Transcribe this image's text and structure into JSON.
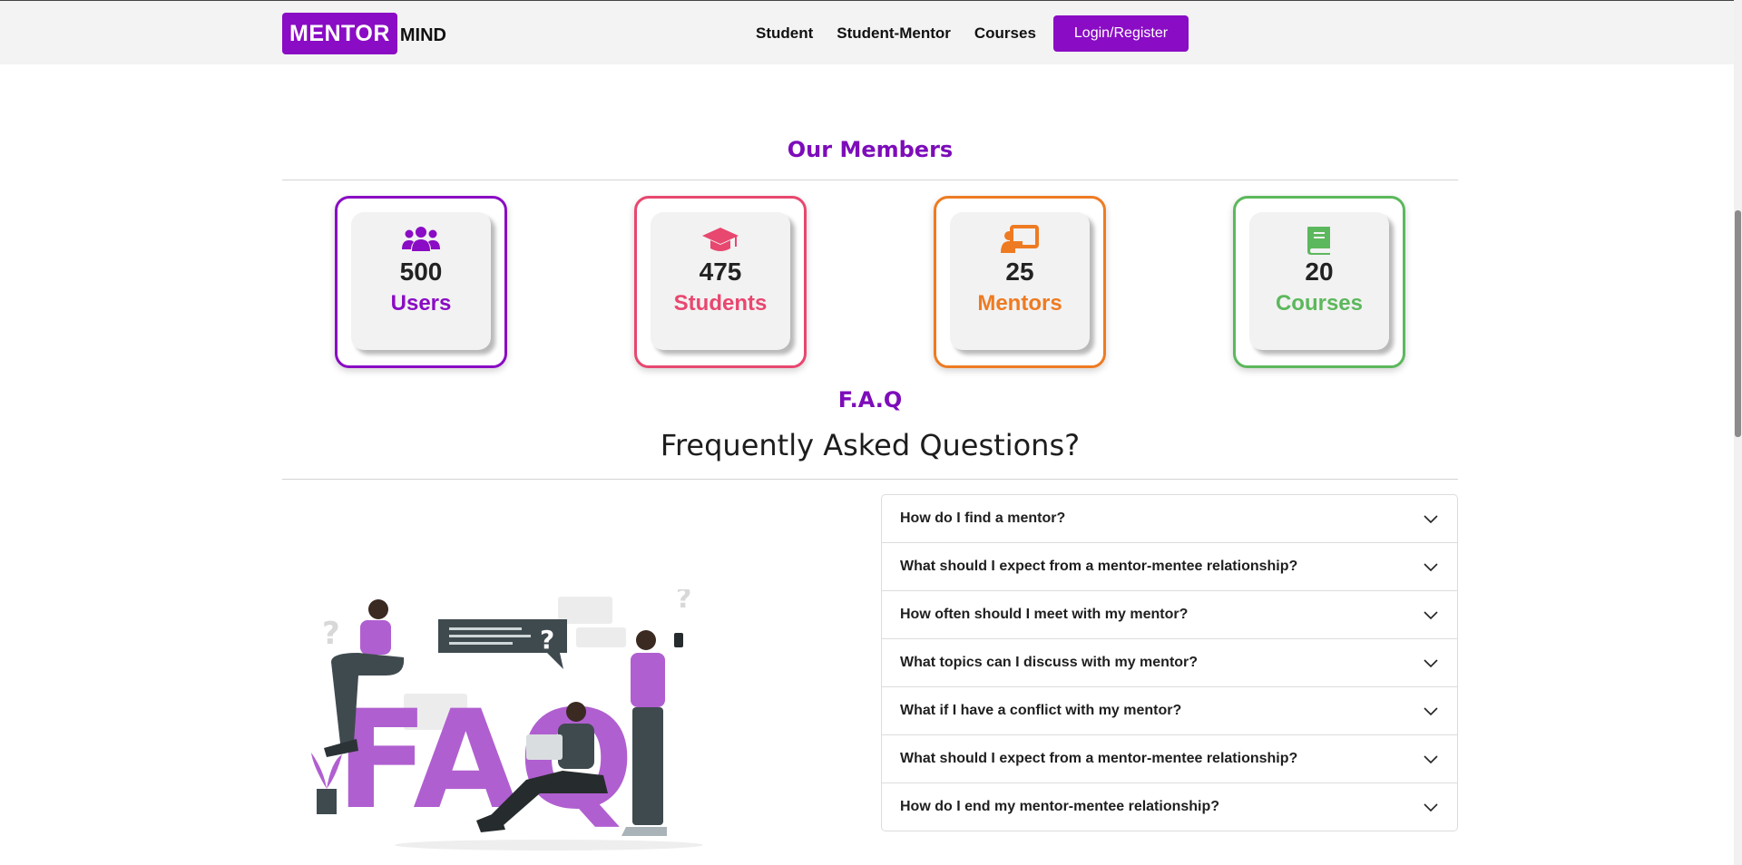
{
  "brand": {
    "box_text": "MENTOR",
    "rest_text": "MIND"
  },
  "nav": {
    "links": [
      "Student",
      "Student-Mentor",
      "Courses"
    ],
    "cta": "Login/Register"
  },
  "members": {
    "title": "Our Members",
    "stats": [
      {
        "number": "500",
        "label": "Users",
        "color": "#8a0cc4",
        "icon": "users-icon"
      },
      {
        "number": "475",
        "label": "Students",
        "color": "#e8476f",
        "icon": "graduation-cap-icon"
      },
      {
        "number": "25",
        "label": "Mentors",
        "color": "#ee7b22",
        "icon": "chalkboard-teacher-icon"
      },
      {
        "number": "20",
        "label": "Courses",
        "color": "#5cb85c",
        "icon": "book-icon"
      }
    ]
  },
  "faq": {
    "small_title": "F.A.Q",
    "heading": "Frequently Asked Questions?",
    "questions": [
      "How do I find a mentor?",
      "What should I expect from a mentor-mentee relationship?",
      "How often should I meet with my mentor?",
      "What topics can I discuss with my mentor?",
      "What if I have a conflict with my mentor?",
      "What should I expect from a mentor-mentee relationship?",
      "How do I end my mentor-mentee relationship?"
    ],
    "illustration_letters": "FAQ"
  },
  "colors": {
    "accent": "#8a0cc4",
    "heading_accent": "#7d0cba"
  }
}
